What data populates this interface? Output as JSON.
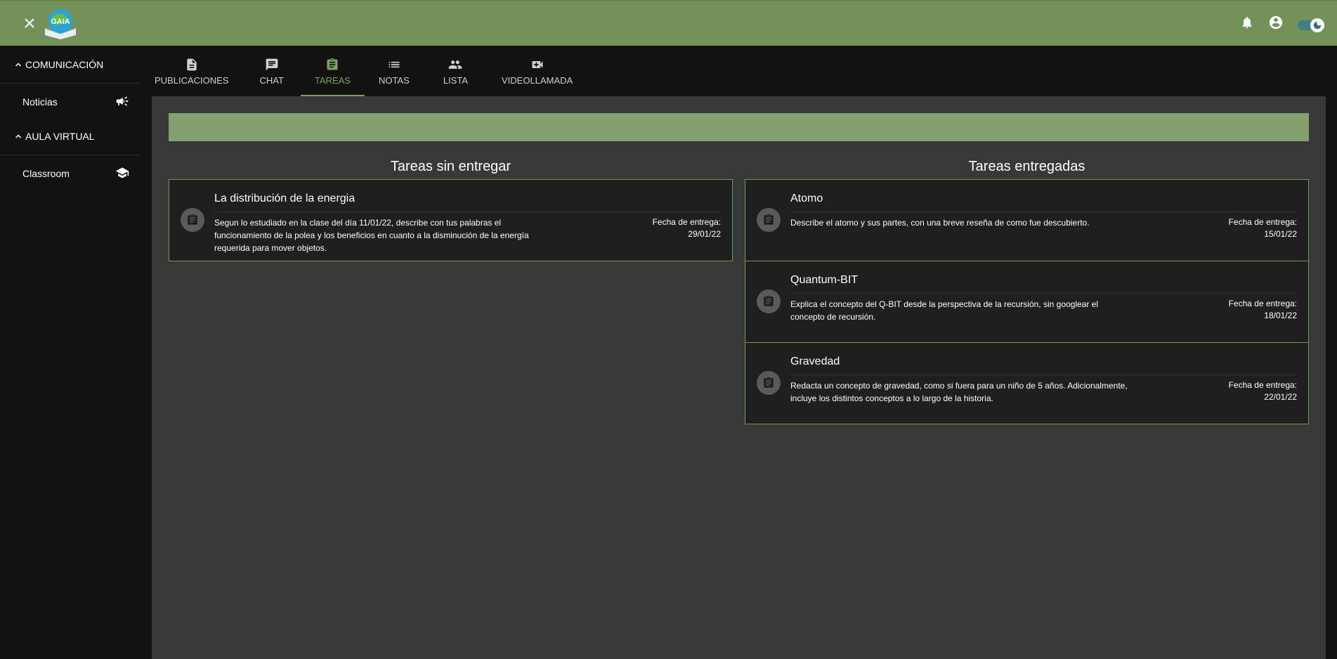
{
  "app": {
    "logo_text": "GAIA"
  },
  "sidebar": {
    "sections": [
      {
        "label": "COMUNICACIÓN",
        "items": [
          {
            "label": "Noticias",
            "icon": "campaign-icon"
          }
        ]
      },
      {
        "label": "AULA VIRTUAL",
        "items": [
          {
            "label": "Classroom",
            "icon": "school-icon"
          }
        ]
      }
    ]
  },
  "tabs": [
    {
      "label": "PUBLICACIONES",
      "icon": "article-icon",
      "active": false
    },
    {
      "label": "CHAT",
      "icon": "chat-icon",
      "active": false
    },
    {
      "label": "TAREAS",
      "icon": "assignment-icon",
      "active": true
    },
    {
      "label": "NOTAS",
      "icon": "list-icon",
      "active": false
    },
    {
      "label": "LISTA",
      "icon": "people-icon",
      "active": false
    },
    {
      "label": "VIDEOLLAMADA",
      "icon": "video-call-icon",
      "active": false
    }
  ],
  "pending": {
    "title": "Tareas sin entregar",
    "tasks": [
      {
        "title": "La distribución de la energia",
        "description": "Segun lo estudiado en la clase del día 11/01/22, describe con tus palabras el funcionamiento de la polea y los beneficios en cuanto a la disminución de la energía requerida para mover objetos.",
        "due_label": "Fecha de entrega:",
        "due_date": "29/01/22"
      }
    ]
  },
  "delivered": {
    "title": "Tareas entregadas",
    "tasks": [
      {
        "title": "Atomo",
        "description": "Describe el atomo y sus partes, con una breve reseña de como fue descubierto.",
        "due_label": "Fecha de entrega:",
        "due_date": "15/01/22"
      },
      {
        "title": "Quantum-BIT",
        "description": "Explica el concepto del Q-BIT desde la perspectiva de la recursión, sin googlear el concepto de recursión.",
        "due_label": "Fecha de entrega:",
        "due_date": "18/01/22"
      },
      {
        "title": "Gravedad",
        "description": "Redacta un concepto de gravedad, como si fuera para un niño de 5 años. Adicionalmente, incluye los distintos conceptos a lo largo de la historia.",
        "due_label": "Fecha de entrega:",
        "due_date": "22/01/22"
      }
    ]
  },
  "colors": {
    "topbar": "#72925a",
    "accent": "#79a35e",
    "banner": "#84a06f",
    "card_border": "#6e9a4f"
  }
}
